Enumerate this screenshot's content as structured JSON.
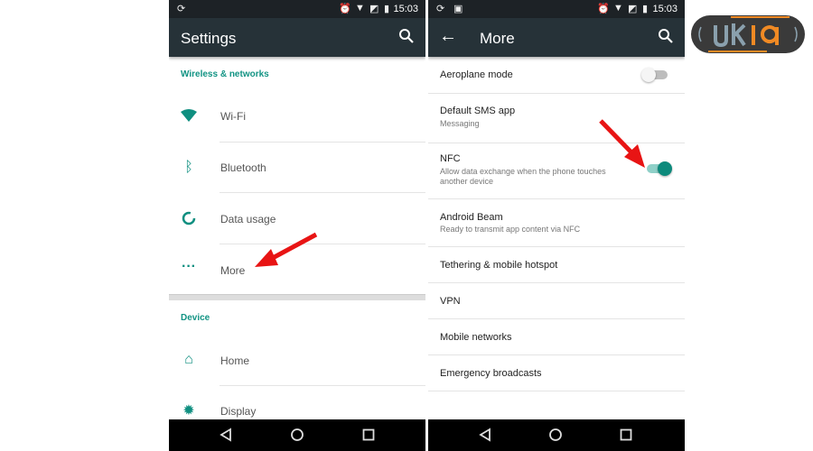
{
  "status_bar": {
    "time": "15:03"
  },
  "left": {
    "title": "Settings",
    "sections": [
      {
        "header": "Wireless & networks",
        "items": [
          {
            "label": "Wi-Fi",
            "icon": "wifi-icon"
          },
          {
            "label": "Bluetooth",
            "icon": "bluetooth-icon"
          },
          {
            "label": "Data usage",
            "icon": "data-usage-icon"
          },
          {
            "label": "More",
            "icon": "more-dots-icon"
          }
        ]
      },
      {
        "header": "Device",
        "items": [
          {
            "label": "Home",
            "icon": "home-icon"
          },
          {
            "label": "Display",
            "icon": "brightness-icon"
          }
        ]
      }
    ]
  },
  "right": {
    "title": "More",
    "items": [
      {
        "label": "Aeroplane mode",
        "toggle": false
      },
      {
        "label": "Default SMS app",
        "sub": "Messaging"
      },
      {
        "label": "NFC",
        "sub": "Allow data exchange when the phone touches another device",
        "toggle": true
      },
      {
        "label": "Android Beam",
        "sub": "Ready to transmit app content via NFC"
      },
      {
        "label": "Tethering & mobile hotspot"
      },
      {
        "label": "VPN"
      },
      {
        "label": "Mobile networks"
      },
      {
        "label": "Emergency broadcasts"
      }
    ]
  },
  "colors": {
    "accent": "#009688",
    "toolbar": "#263238",
    "arrow": "#e81414"
  },
  "logo": {
    "text": "UK19"
  }
}
